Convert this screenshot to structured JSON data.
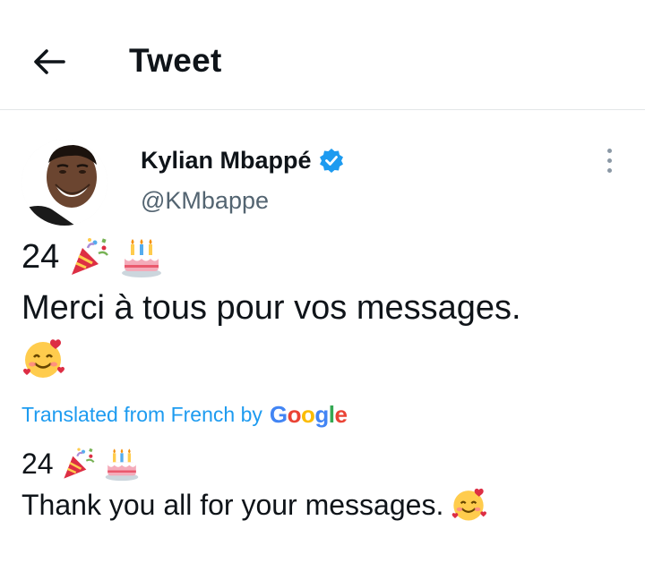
{
  "header": {
    "title": "Tweet",
    "back_icon": "arrow-left-icon"
  },
  "author": {
    "display_name": "Kylian Mbappé",
    "handle": "@KMbappe",
    "verified_icon": "verified-badge-icon",
    "avatar": "profile-avatar"
  },
  "tweet": {
    "line1_text": "24",
    "line1_emojis": [
      "party-popper-emoji",
      "birthday-cake-emoji"
    ],
    "line2_text": "Merci à tous pour vos messages.",
    "line3_emojis": [
      "smiling-face-with-hearts-emoji"
    ]
  },
  "translation_notice": {
    "label": "Translated from French by",
    "provider": "Google"
  },
  "translation": {
    "line1_text": "24",
    "line1_emojis": [
      "party-popper-emoji",
      "birthday-cake-emoji"
    ],
    "line2_text": "Thank you all for your messages.",
    "line2_emojis": [
      "smiling-face-with-hearts-emoji"
    ]
  },
  "colors": {
    "link": "#1d9bf0",
    "secondary_text": "#536471",
    "primary_text": "#0f1419",
    "verified": "#1d9bf0"
  }
}
